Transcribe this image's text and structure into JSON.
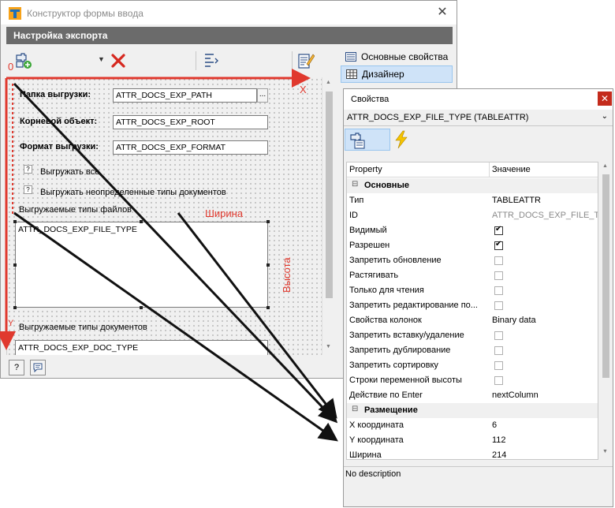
{
  "window": {
    "title": "Конструктор формы ввода",
    "header": "Настройка экспорта"
  },
  "sidebar": {
    "items": [
      {
        "label": "Основные свойства"
      },
      {
        "label": "Дизайнер"
      }
    ]
  },
  "designer": {
    "labels": {
      "folder": "Папка выгрузки:",
      "root": "Корневой объект:",
      "format": "Формат выгрузки:",
      "export_all": "Выгружать все",
      "export_undefined": "Выгружать неопределенные типы документов",
      "file_types": "Выгружаемые типы файлов",
      "doc_types": "Выгружаемые типы документов"
    },
    "fields": {
      "folder": "ATTR_DOCS_EXP_PATH",
      "root": "ATTR_DOCS_EXP_ROOT",
      "format": "ATTR_DOCS_EXP_FORMAT",
      "file_type": "ATTR_DOCS_EXP_FILE_TYPE",
      "doc_type": "ATTR_DOCS_EXP_DOC_TYPE"
    },
    "browse": "...",
    "check_mark": "?"
  },
  "annotations": {
    "origin": "0",
    "x": "X",
    "y": "Y",
    "width": "Ширина",
    "height": "Высота"
  },
  "properties": {
    "title": "Свойства",
    "object": "ATTR_DOCS_EXP_FILE_TYPE (TABLEATTR)",
    "columns": {
      "property": "Property",
      "value": "Значение"
    },
    "categories": {
      "basic": "Основные",
      "layout": "Размещение"
    },
    "rows": [
      {
        "key": "Тип",
        "value": "TABLEATTR"
      },
      {
        "key": "ID",
        "value": "ATTR_DOCS_EXP_FILE_T..."
      },
      {
        "key": "Видимый",
        "checked": true
      },
      {
        "key": "Разрешен",
        "checked": true
      },
      {
        "key": "Запретить обновление",
        "checked": false
      },
      {
        "key": "Растягивать",
        "checked": false
      },
      {
        "key": "Только для чтения",
        "checked": false
      },
      {
        "key": "Запретить редактирование по...",
        "checked": false
      },
      {
        "key": "Свойства колонок",
        "value": "Binary data"
      },
      {
        "key": "Запретить вставку/удаление",
        "checked": false
      },
      {
        "key": "Запретить дублирование",
        "checked": false
      },
      {
        "key": "Запретить сортировку",
        "checked": false
      },
      {
        "key": "Строки переменной высоты",
        "checked": false
      },
      {
        "key": "Действие по Enter",
        "value": "nextColumn"
      }
    ],
    "layout_rows": [
      {
        "key": "X координата",
        "value": "6"
      },
      {
        "key": "Y координата",
        "value": "112"
      },
      {
        "key": "Ширина",
        "value": "214"
      }
    ],
    "description": "No description"
  },
  "colors": {
    "accent_red": "#e0392e",
    "selection": "#cfe3f8",
    "header": "#6b6b6b"
  }
}
